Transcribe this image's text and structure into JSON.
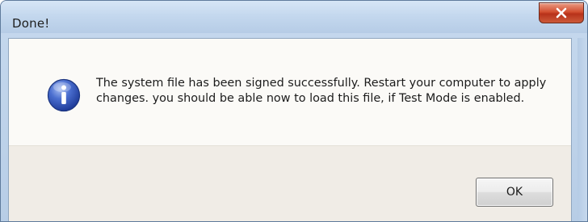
{
  "window": {
    "title": "Done!",
    "close_label": "close"
  },
  "message": {
    "text": "The system file has been signed successfully. Restart your computer to apply changes. you should be able now to load this file, if Test Mode is enabled.",
    "icon": "info-icon"
  },
  "buttons": {
    "ok_label": "OK"
  },
  "colors": {
    "titlebar": "#c4d8ee",
    "close_button": "#c8452a",
    "content_background": "#fbfaf7",
    "footer_background": "#f0ece6",
    "info_icon": "#2f52b8"
  }
}
